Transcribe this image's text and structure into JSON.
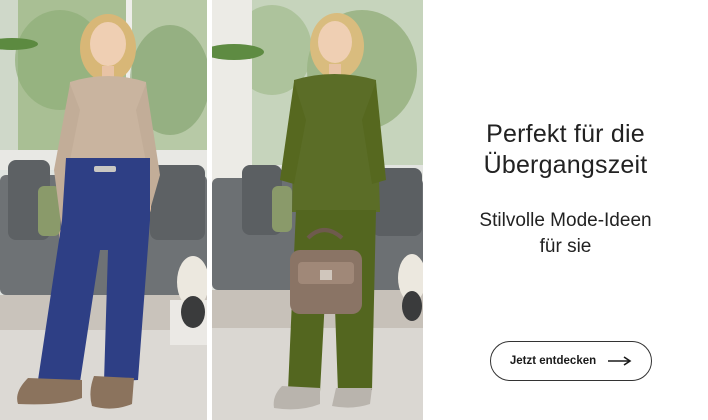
{
  "banner": {
    "headline_line1": "Perfekt für die",
    "headline_line2": "Übergangszeit",
    "subline_line1": "Stilvolle Mode-Ideen",
    "subline_line2": "für sie",
    "cta_label": "Jetzt entdecken",
    "cta_icon": "arrow-right-icon"
  },
  "colors": {
    "text": "#222222",
    "button_border": "#333333",
    "background": "#ffffff"
  }
}
